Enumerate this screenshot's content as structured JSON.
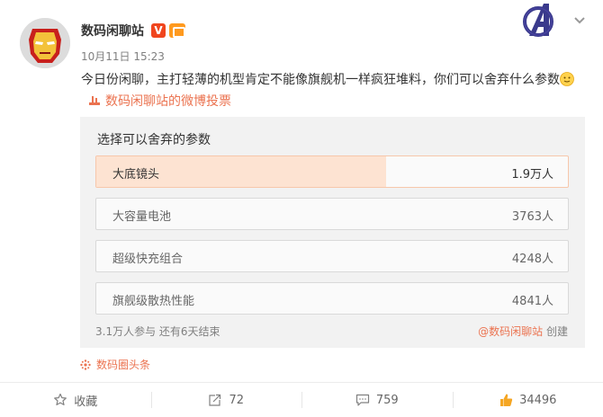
{
  "post": {
    "author": "数码闲聊站",
    "verified_badge": "V",
    "timestamp": "10月11日 15:23",
    "text": "今日份闲聊，主打轻薄的机型肯定不能像旗舰机一样疯狂堆料，你们可以舍弃什么参数",
    "vote_link": "数码闲聊站的微博投票"
  },
  "poll": {
    "title": "选择可以舍弃的参数",
    "options": [
      {
        "label": "大底镜头",
        "count": "1.9万人",
        "share": 0.615
      },
      {
        "label": "大容量电池",
        "count": "3763人",
        "share": 0.121
      },
      {
        "label": "超级快充组合",
        "count": "4248人",
        "share": 0.137
      },
      {
        "label": "旗舰级散热性能",
        "count": "4841人",
        "share": 0.156
      }
    ],
    "participants": "3.1万人参与 还有6天结束",
    "creator_mention": "@数码闲聊站",
    "creator_suffix": "创建"
  },
  "topic": {
    "label": "数码圈头条"
  },
  "actions": {
    "favorite": "收藏",
    "repost": "72",
    "comment": "759",
    "like": "34496"
  },
  "colors": {
    "accent": "#eb7350",
    "selected_fill": "#fde3d2",
    "poll_bg": "#f2f2f2"
  },
  "icons": [
    "iron-man-avatar-icon",
    "avengers-logo-icon",
    "chevron-down-icon",
    "smiley-emoji-icon",
    "vote-icon",
    "topic-icon",
    "star-icon",
    "repost-icon",
    "comment-icon",
    "like-icon"
  ]
}
